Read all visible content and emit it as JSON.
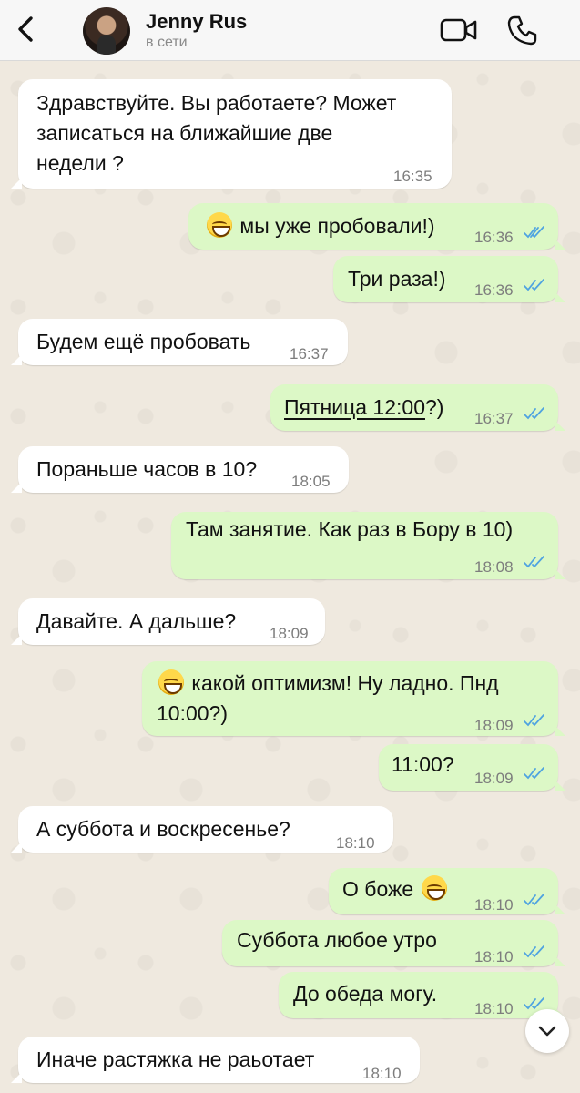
{
  "header": {
    "contact_name": "Jenny Rus",
    "status": "в сети",
    "icons": {
      "back": "chevron-left-icon",
      "video": "video-camera-icon",
      "call": "phone-icon"
    }
  },
  "colors": {
    "incoming": "#ffffff",
    "outgoing": "#dcf8c6",
    "tick": "#4fa3e0",
    "chat_bg": "#efe9df"
  },
  "messages": [
    {
      "dir": "in",
      "text": "Здравствуйте. Вы работаете? Может\nзаписаться на ближайшие две\nнедели ?",
      "time": "16:35"
    },
    {
      "dir": "out",
      "emoji": "grinning-face",
      "text": "мы уже пробовали!)",
      "time": "16:36",
      "read": true
    },
    {
      "dir": "out",
      "text": "Три раза!)",
      "time": "16:36",
      "read": true
    },
    {
      "dir": "in",
      "text": "Будем ещё пробовать",
      "time": "16:37"
    },
    {
      "dir": "out",
      "link": "Пятница 12:00",
      "text": "?)",
      "time": "16:37",
      "read": true
    },
    {
      "dir": "in",
      "text": "Пораньше часов в 10?",
      "time": "18:05"
    },
    {
      "dir": "out",
      "text": "Там занятие. Как раз в Бору в 10)",
      "time": "18:08",
      "read": true
    },
    {
      "dir": "in",
      "text": "Давайте. А дальше?",
      "time": "18:09"
    },
    {
      "dir": "out",
      "emoji": "grinning-face",
      "text": "какой оптимизм! Ну ладно. Пнд\n10:00?)",
      "time": "18:09",
      "read": true
    },
    {
      "dir": "out",
      "text": "11:00?",
      "time": "18:09",
      "read": true
    },
    {
      "dir": "in",
      "text": "А суббота и воскресенье?",
      "time": "18:10"
    },
    {
      "dir": "out",
      "text": "О боже",
      "emoji_after": "grinning-face",
      "time": "18:10",
      "read": true
    },
    {
      "dir": "out",
      "text": "Суббота любое утро",
      "time": "18:10",
      "read": true
    },
    {
      "dir": "out",
      "text": "До обеда могу.",
      "time": "18:10",
      "read": true
    },
    {
      "dir": "in",
      "text": "Иначе растяжка не раьотает",
      "time": "18:10"
    }
  ],
  "scroll_button": {
    "icon": "chevron-down-icon"
  }
}
